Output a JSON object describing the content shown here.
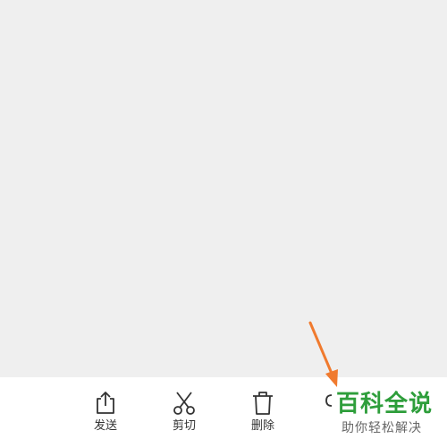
{
  "toolbar": {
    "send_label": "发送",
    "cut_label": "剪切",
    "delete_label": "删除"
  },
  "icons": {
    "send": "share-upload-icon",
    "cut": "scissors-icon",
    "delete": "trash-icon"
  },
  "colors": {
    "background": "#efefef",
    "toolbar": "#ffffff",
    "arrow": "#f07a2e",
    "watermark_title": "#2e9e3b",
    "watermark_sub": "#666666"
  },
  "watermark": {
    "title": "百科全说",
    "subtitle": "助你轻松解决"
  }
}
